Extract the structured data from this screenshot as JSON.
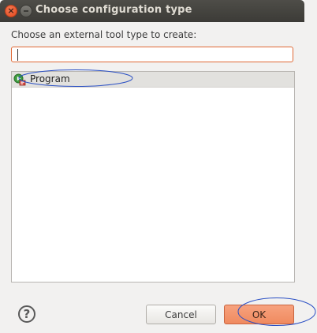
{
  "window": {
    "title": "Choose configuration type",
    "close_glyph": "×"
  },
  "dialog": {
    "prompt": "Choose an external tool type to create:",
    "search": {
      "value": "",
      "placeholder": ""
    },
    "tree": {
      "items": [
        {
          "label": "Program",
          "icon": "program-launch-icon",
          "selected": true
        }
      ]
    }
  },
  "buttons": {
    "help_glyph": "?",
    "cancel_label": "Cancel",
    "ok_label": "OK"
  },
  "colors": {
    "accent": "#f08a5f",
    "titlebar": "#3c3b37",
    "annotation": "#2a4fc4"
  }
}
